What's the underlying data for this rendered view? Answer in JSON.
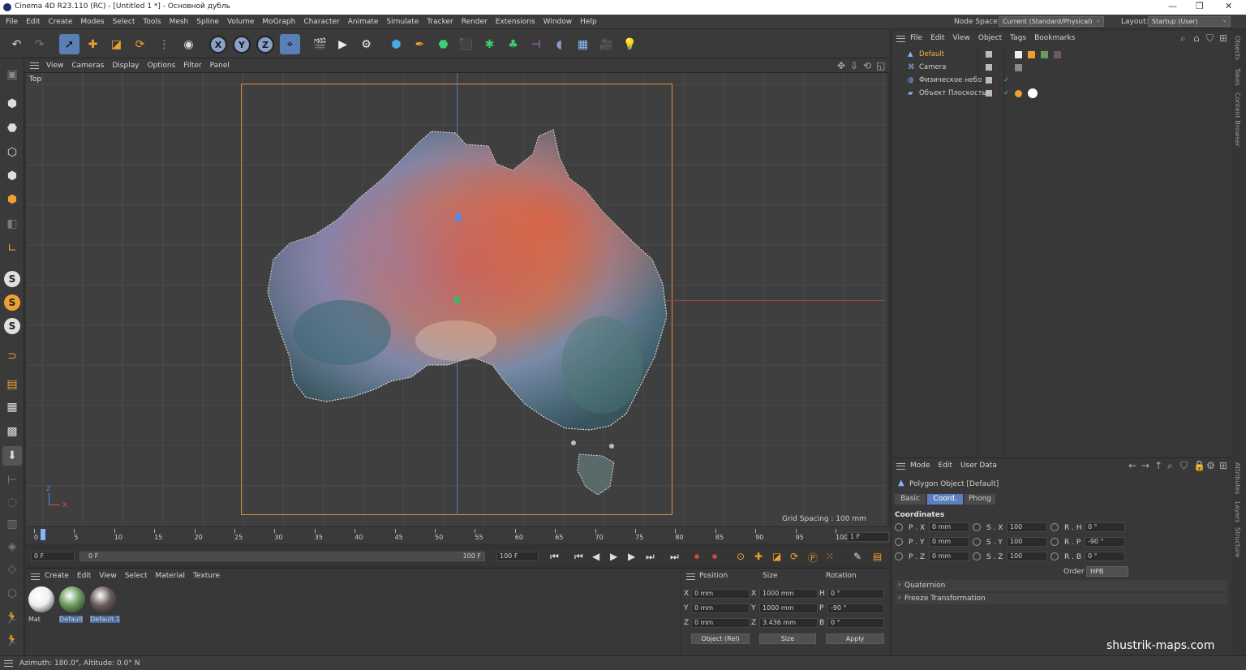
{
  "window": {
    "title": "Cinema 4D R23.110 (RC) - [Untitled 1 *] - Основной дубль",
    "controls": [
      "—",
      "❐",
      "✕"
    ]
  },
  "menubar": {
    "items": [
      "File",
      "Edit",
      "Create",
      "Modes",
      "Select",
      "Tools",
      "Mesh",
      "Spline",
      "Volume",
      "MoGraph",
      "Character",
      "Animate",
      "Simulate",
      "Tracker",
      "Render",
      "Extensions",
      "Window",
      "Help"
    ],
    "node_space_label": "Node Space:",
    "node_space_value": "Current (Standard/Physical)",
    "layout_label": "Layout:",
    "layout_value": "Startup (User)"
  },
  "viewport": {
    "menu": [
      "View",
      "Cameras",
      "Display",
      "Options",
      "Filter",
      "Panel"
    ],
    "view_name": "Top",
    "grid_spacing": "Grid Spacing : 100 mm",
    "axis_z": "Z",
    "axis_x": "X"
  },
  "timeline": {
    "ticks": [
      "0",
      "5",
      "10",
      "15",
      "20",
      "25",
      "30",
      "35",
      "40",
      "45",
      "50",
      "55",
      "60",
      "65",
      "70",
      "75",
      "80",
      "85",
      "90",
      "95",
      "100"
    ],
    "current_frame": "1 F",
    "start_field": "0 F",
    "range_start": "0 F",
    "range_end": "100 F",
    "end_field": "100 F"
  },
  "materials": {
    "menu": [
      "Create",
      "Edit",
      "View",
      "Select",
      "Material",
      "Texture"
    ],
    "items": [
      {
        "name": "Mat",
        "color": "#f0f0f0"
      },
      {
        "name": "Default",
        "color": "#6b9a5a"
      },
      {
        "name": "Default.1",
        "color": "#6a5a5a"
      }
    ]
  },
  "coords": {
    "headers": [
      "Position",
      "Size",
      "Rotation"
    ],
    "rows": [
      {
        "axis": "X",
        "pos": "0 mm",
        "size_axis": "X",
        "size": "1000 mm",
        "rot_axis": "H",
        "rot": "0 °"
      },
      {
        "axis": "Y",
        "pos": "0 mm",
        "size_axis": "Y",
        "size": "1000 mm",
        "rot_axis": "P",
        "rot": "-90 °"
      },
      {
        "axis": "Z",
        "pos": "0 mm",
        "size_axis": "Z",
        "size": "3.436 mm",
        "rot_axis": "B",
        "rot": "0 °"
      }
    ],
    "mode_select": "Object (Rel)",
    "size_select": "Size",
    "apply": "Apply"
  },
  "objects": {
    "menu": [
      "File",
      "Edit",
      "View",
      "Object",
      "Tags",
      "Bookmarks"
    ],
    "items": [
      {
        "name": "Default",
        "color": "#f0b040",
        "icon": "polygon-object-icon"
      },
      {
        "name": "Camera",
        "color": "#cfcfcf",
        "icon": "camera-icon"
      },
      {
        "name": "Физическое небо",
        "color": "#cfcfcf",
        "icon": "sky-icon"
      },
      {
        "name": "Объект Плоскость",
        "color": "#cfcfcf",
        "icon": "plane-icon"
      }
    ]
  },
  "attributes": {
    "menu": [
      "Mode",
      "Edit",
      "User Data"
    ],
    "object_title": "Polygon Object [Default]",
    "tabs": [
      "Basic",
      "Coord.",
      "Phong"
    ],
    "active_tab": "Coord.",
    "section": "Coordinates",
    "rows": [
      {
        "p_label": "P . X",
        "p_val": "0 mm",
        "s_label": "S . X",
        "s_val": "100",
        "r_label": "R . H",
        "r_val": "0 °"
      },
      {
        "p_label": "P . Y",
        "p_val": "0 mm",
        "s_label": "S . Y",
        "s_val": "100",
        "r_label": "R . P",
        "r_val": "-90 °"
      },
      {
        "p_label": "P . Z",
        "p_val": "0 mm",
        "s_label": "S . Z",
        "s_val": "100",
        "r_label": "R . B",
        "r_val": "0 °"
      }
    ],
    "order_label": "Order",
    "order_value": "HPB",
    "groups": [
      "Quaternion",
      "Freeze Transformation"
    ]
  },
  "right_tabs": [
    "Objects",
    "Takes",
    "Content Browser",
    "Attributes",
    "Layers",
    "Structure"
  ],
  "status": {
    "text": "Azimuth: 180.0°, Altitude: 0.0°  N"
  },
  "watermark": "shustrik-maps.com"
}
